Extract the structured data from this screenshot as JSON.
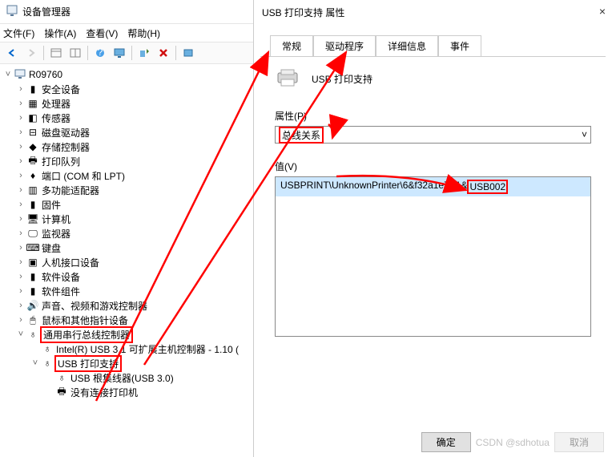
{
  "left": {
    "title": "设备管理器",
    "menu": {
      "file": "文件(F)",
      "action": "操作(A)",
      "view": "查看(V)",
      "help": "帮助(H)"
    },
    "root": "R09760",
    "items": {
      "security": "安全设备",
      "cpu": "处理器",
      "sensor": "传感器",
      "disk": "磁盘驱动器",
      "storage": "存储控制器",
      "printqueue": "打印队列",
      "ports": "端口 (COM 和 LPT)",
      "adapter": "多功能适配器",
      "firmware": "固件",
      "computer": "计算机",
      "monitor": "监视器",
      "keyboard": "键盘",
      "hid": "人机接口设备",
      "softdev": "软件设备",
      "softcomp": "软件组件",
      "sound": "声音、视频和游戏控制器",
      "mouse": "鼠标和其他指针设备",
      "usbctrl": "通用串行总线控制器",
      "usbhost": "Intel(R) USB 3.1 可扩展主机控制器 - 1.10 (",
      "usbprint": "USB 打印支持",
      "usbroot": "USB 根集线器(USB 3.0)",
      "noprinter": "没有连接打印机"
    }
  },
  "right": {
    "title": "USB 打印支持 属性",
    "tabs": {
      "general": "常规",
      "driver": "驱动程序",
      "details": "详细信息",
      "events": "事件"
    },
    "deviceName": "USB 打印支持",
    "propLabel": "属性(P)",
    "propValue": "总线关系",
    "valueLabel": "值(V)",
    "valueTextA": "USBPRINT\\UnknownPrinter\\6&f32a1e7&1&",
    "valueTextB": "USB002",
    "ok": "确定",
    "cancel": "取消"
  },
  "watermark": "CSDN @sdhotua"
}
